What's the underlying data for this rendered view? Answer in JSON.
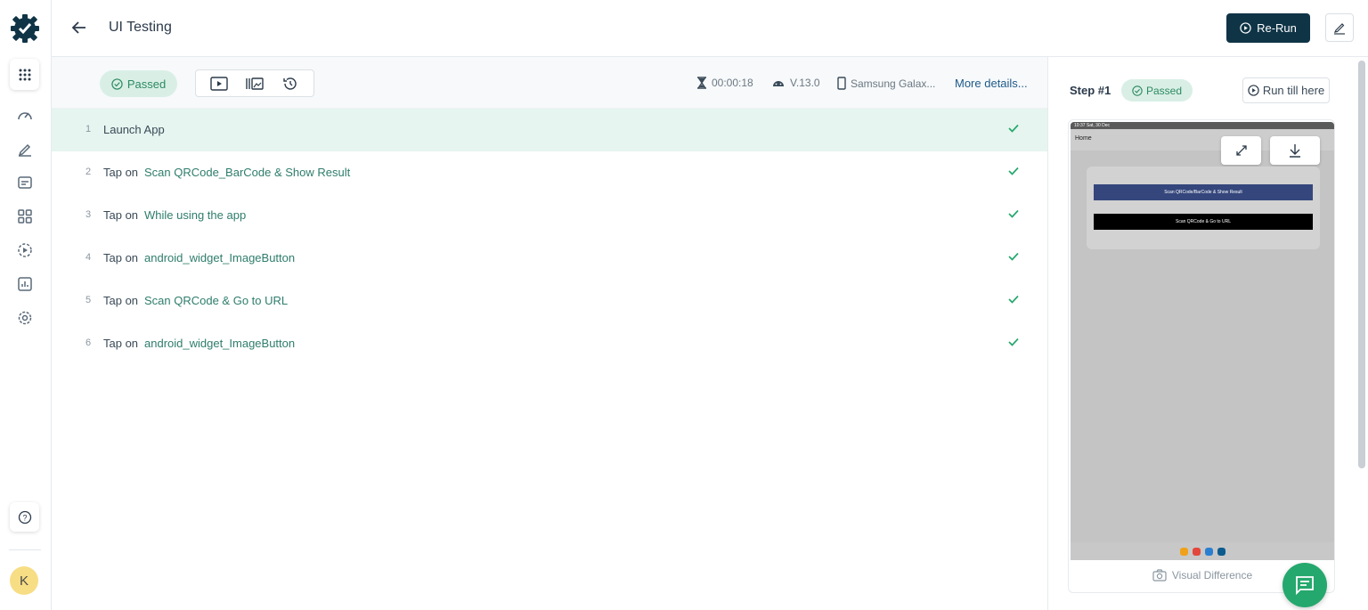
{
  "header": {
    "title": "UI Testing",
    "rerun_label": "Re-Run"
  },
  "toolbar": {
    "status": "Passed",
    "duration": "00:00:18",
    "os_version": "V.13.0",
    "device": "Samsung Galax...",
    "more_details": "More details..."
  },
  "steps": [
    {
      "num": "1",
      "action": "Launch App",
      "target": ""
    },
    {
      "num": "2",
      "action": "Tap on",
      "target": "Scan QRCode_BarCode & Show Result"
    },
    {
      "num": "3",
      "action": "Tap on",
      "target": "While using the app"
    },
    {
      "num": "4",
      "action": "Tap on",
      "target": "android_widget_ImageButton"
    },
    {
      "num": "5",
      "action": "Tap on",
      "target": "Scan QRCode & Go to URL"
    },
    {
      "num": "6",
      "action": "Tap on",
      "target": "android_widget_ImageButton"
    }
  ],
  "detail": {
    "step_label": "Step #1",
    "status": "Passed",
    "run_till_here": "Run till here",
    "visual_difference": "Visual Difference",
    "phone": {
      "statusbar": "10:37  Sat, 30 Dec",
      "appbar_title": "Home",
      "button1": "Scan QRCode/BarCode & Show Result",
      "button2": "Scan QRCode & Go to URL"
    }
  },
  "user": {
    "initial": "K"
  },
  "colors": {
    "brand": "#0f3446",
    "passed": "#25a86d",
    "active_row": "#e6f5ef"
  }
}
